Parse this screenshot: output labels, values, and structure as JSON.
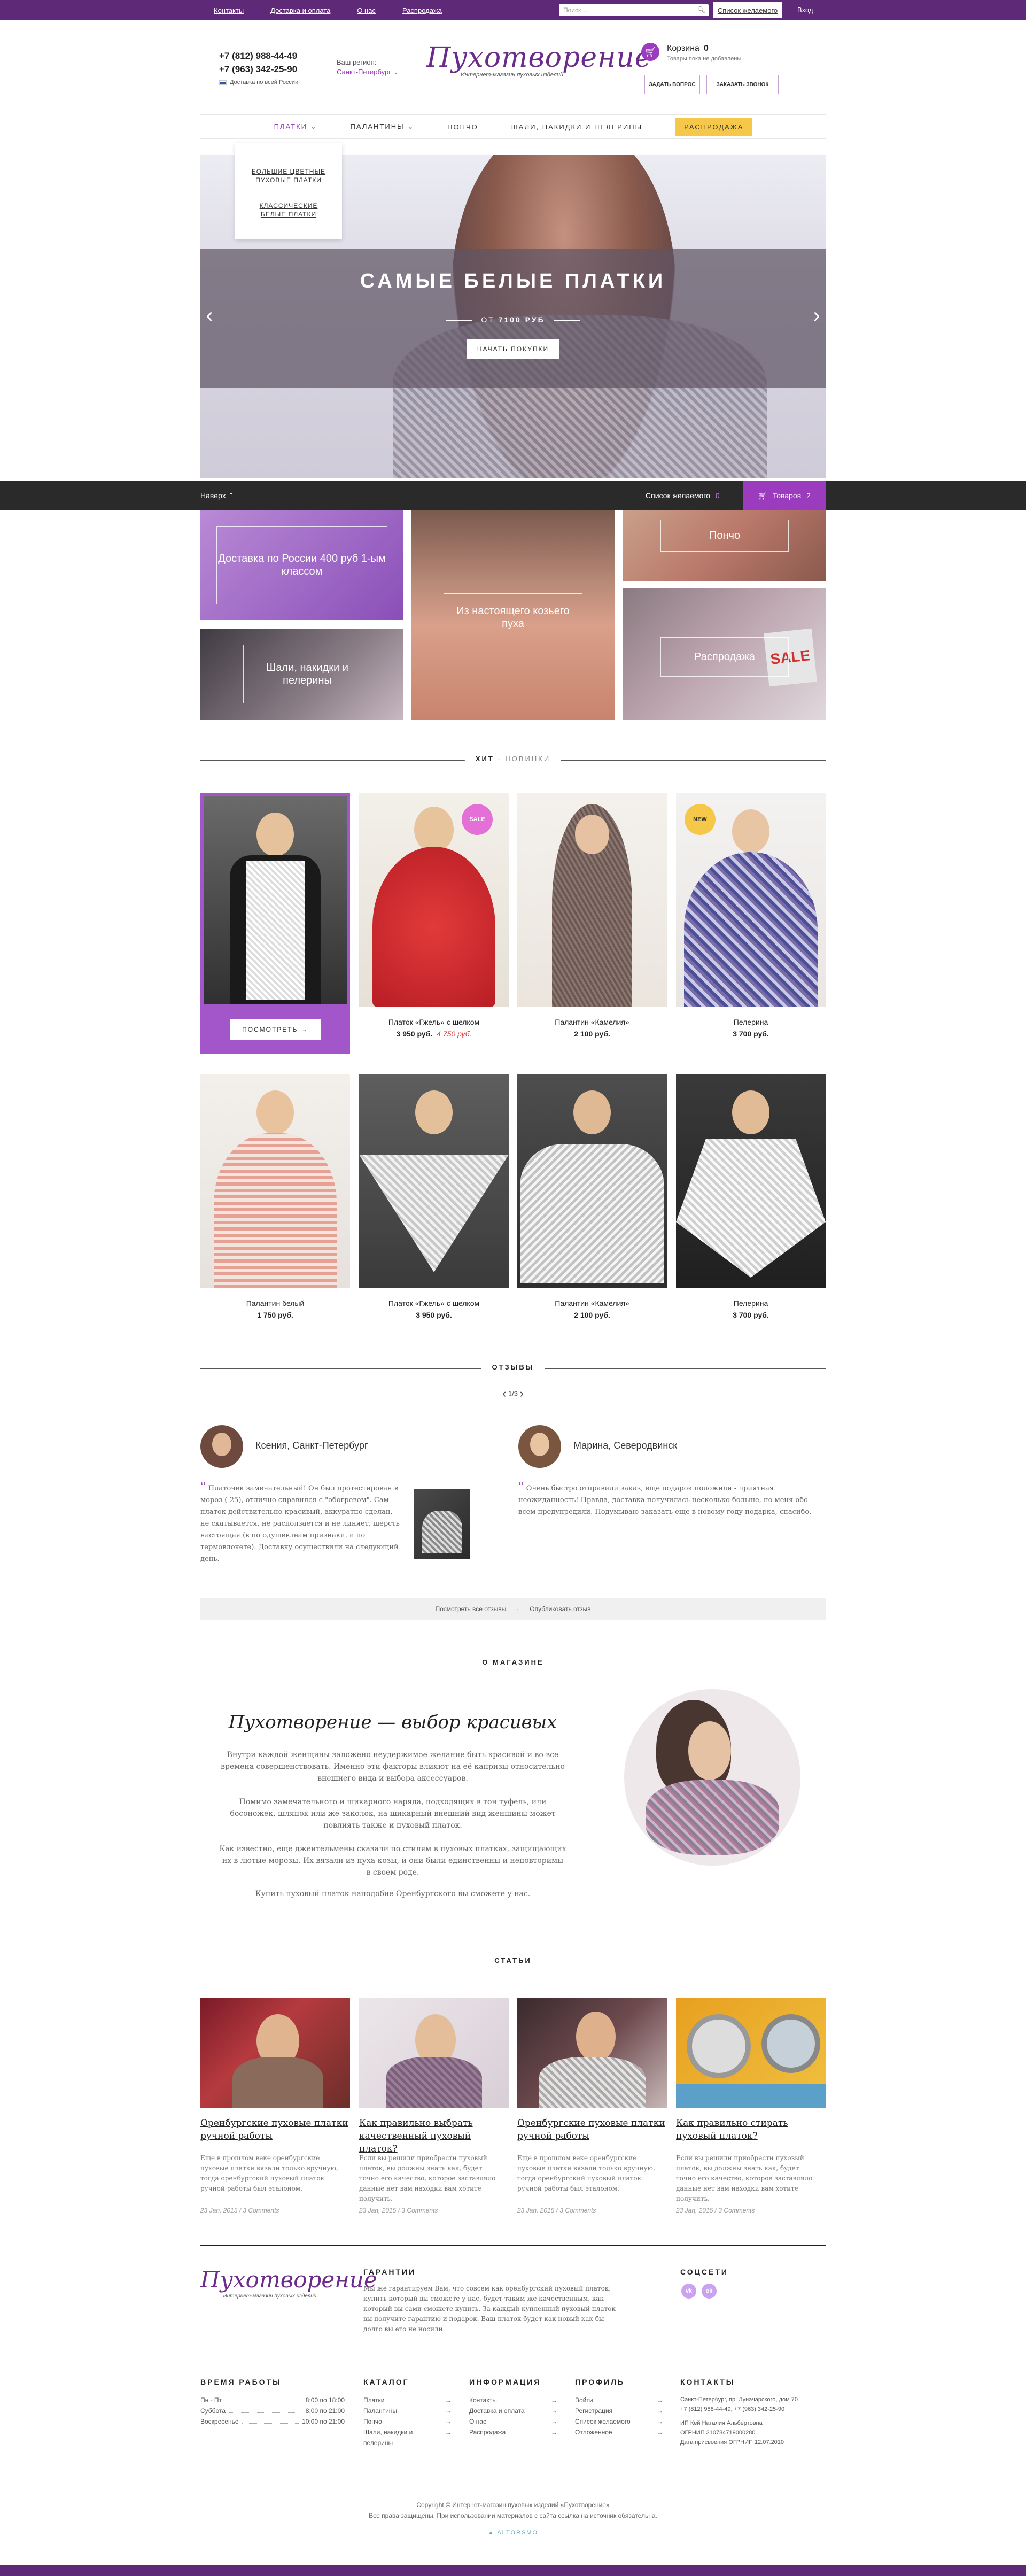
{
  "topbar": {
    "links": [
      "Контакты",
      "Доставка и оплата",
      "О нас",
      "Распродажа"
    ],
    "search_placeholder": "Поиск ...",
    "favorites": "Список желаемого",
    "login": "Вход"
  },
  "header": {
    "phone1": "+7 (812) 988-44-49",
    "phone2": "+7 (963) 342-25-90",
    "delivery_note": "Доставка по всей России",
    "region_label": "Ваш регион:",
    "region_value": "Санкт-Петербург",
    "logo_title": "Пухотворение",
    "logo_subtitle": "Интернет-магазин пуховых изделий",
    "cart_label": "Корзина",
    "cart_count": "0",
    "cart_note": "Товары пока не добавлены",
    "btn_question": "ЗАДАТЬ ВОПРОС",
    "btn_callback": "ЗАКАЗАТЬ ЗВОНОК"
  },
  "nav": {
    "items": [
      "ПЛАТКИ",
      "ПАЛАНТИНЫ",
      "ПОНЧО",
      "ШАЛИ, НАКИДКИ И ПЕЛЕРИНЫ"
    ],
    "sale": "РАСПРОДАЖА",
    "dropdown": [
      "БОЛЬШИЕ ЦВЕТНЫЕ ПУХОВЫЕ ПЛАТКИ",
      "КЛАССИЧЕСКИЕ БЕЛЫЕ ПЛАТКИ"
    ]
  },
  "hero": {
    "title": "САМЫЕ БЕЛЫЕ ПЛАТКИ",
    "price_prefix": "ОТ",
    "price": "7100 РУБ",
    "button": "НАЧАТЬ ПОКУПКИ"
  },
  "stickybar": {
    "up": "Наверх",
    "favorites": "Список желаемого",
    "fav_count": "0",
    "goods": "Товаров",
    "goods_count": "2"
  },
  "promos": {
    "delivery": "Доставка по России 400 руб 1-ым классом",
    "goat": "Из настоящего козьего пуха",
    "poncho": "Пончо",
    "shawls": "Шали, накидки и пелерины",
    "sale": "Распродажа",
    "sale_sign": "SALE"
  },
  "sections": {
    "hit": "ХИТ",
    "sep": "·",
    "new": "НОВИНКИ",
    "reviews": "ОТЗЫВЫ",
    "about": "О МАГАЗИНЕ",
    "articles": "СТАТЬИ"
  },
  "products": {
    "view_button": "ПОСМОТРЕТЬ",
    "row1": [
      {
        "name": "",
        "price": "",
        "old": ""
      },
      {
        "name": "Платок «Гжель» с шелком",
        "price": "3 950 руб.",
        "old": "4 750 руб."
      },
      {
        "name": "Палантин «Камелия»",
        "price": "2 100 руб.",
        "old": ""
      },
      {
        "name": "Пелерина",
        "price": "3 700 руб.",
        "old": ""
      }
    ],
    "row2": [
      {
        "name": "Палантин белый",
        "price": "1 750 руб."
      },
      {
        "name": "Платок «Гжель» с шелком",
        "price": "3 950 руб."
      },
      {
        "name": "Палантин «Камелия»",
        "price": "2 100 руб."
      },
      {
        "name": "Пелерина",
        "price": "3 700 руб."
      }
    ],
    "badge_sale": "SALE",
    "badge_new": "NEW"
  },
  "reviews": {
    "counter": "1/3",
    "items": [
      {
        "name": "Ксения, Санкт-Петербург",
        "text": "Платочек замечательный! Он был протестирован в мороз (-25), отлично справился с \"обогревом\". Сам платок действительно красивый, аккуратно сделан, не скатывается, не расползается и не линяет, шерсть настоящая (в по одушевлеам признаки, и по термовлокете). Доставку осуществили на следующий день."
      },
      {
        "name": "Марина, Северодвинск",
        "text": "Очень быстро отправили заказ, еще подарок положили - приятная неожиданность! Правда, доставка получилась несколько больше, но меня обо всем предупредили. Подумываю заказать еще в новому году подарка, спасибо."
      }
    ],
    "all_link": "Посмотреть все отзывы",
    "publish_link": "Опубликовать отзыв"
  },
  "about": {
    "heading": "Пухотворение — выбор красивых",
    "p1": "Внутри каждой женщины заложено неудержимое желание быть красивой и во все времена совершенствовать. Именно эти факторы влияют на её капризы относительно внешнего вида и выбора аксессуаров.",
    "p2": "Помимо замечательного и шикарного наряда, подходящих в тон туфель, или босоножек, шляпок или же заколок, на шикарный внешний вид женщины может повлиять также и пуховый платок.",
    "p3": "Как известно, еще джентельмены сказали по стилям в пуховых платках, защищающих их в лютые морозы. Их вязали из пуха козы, и они были единственны и неповторимы в своем роде.",
    "p4": "Купить пуховый платок наподобие Оренбургского вы сможете у нас."
  },
  "articles": [
    {
      "title": "Оренбургские пуховые платки ручной работы",
      "desc": "Еще в прошлом веке оренбургские пуховые платки вязали только вручную, тогда оренбургский пуховый платок ручной работы был эталоном.",
      "meta": "23 Jan, 2015 / 3 Comments"
    },
    {
      "title": "Как правильно выбрать качественный пуховый платок?",
      "desc": "Если вы решили приобрести пуховый платок, вы должны знать как, будет точно его качество, которое заставляло данные нет вам находки вам хотите получить.",
      "meta": "23 Jan, 2015 / 3 Comments"
    },
    {
      "title": "Оренбургские пуховые платки ручной работы",
      "desc": "Еще в прошлом веке оренбургские пуховые платки вязали только вручную, тогда оренбургский пуховый платок ручной работы был эталоном.",
      "meta": "23 Jan, 2015 / 3 Comments"
    },
    {
      "title": "Как правильно стирать пуховый платок?",
      "desc": "Если вы решили приобрести пуховый платок, вы должны знать как, будет точно его качество, которое заставляло данные нет вам находки вам хотите получить.",
      "meta": "23 Jan, 2015 / 3 Comments"
    }
  ],
  "footer": {
    "logo_title": "Пухотворение",
    "logo_subtitle": "Интернет-магазин пуховых изделий",
    "guarantee_h": "ГАРАНТИИ",
    "guarantee_text": "Мы же гарантируем Вам, что совсем как оренбургский пуховый платок, купить который вы сможете у нас, будет таким же качественным, как который вы сами сможете купить. За каждый купленный пуховый платок вы получите гарантию и подарок. Ваш платок будет как новый как бы долго вы его не носили.",
    "social_h": "СОЦСЕТИ",
    "soc1": "vk",
    "soc2": "ok",
    "hours_h": "ВРЕМЯ РАБОТЫ",
    "hours": [
      {
        "d": "Пн - Пт",
        "t": "8:00 по 18:00"
      },
      {
        "d": "Суббота",
        "t": "8:00 по 21:00"
      },
      {
        "d": "Воскресенье",
        "t": "10:00 по 21:00"
      }
    ],
    "catalog_h": "КАТАЛОГ",
    "catalog": [
      "Платки",
      "Палантины",
      "Пончо",
      "Шали, накидки и пелерины"
    ],
    "info_h": "ИНФОРМАЦИЯ",
    "info": [
      "Контакты",
      "Доставка и оплата",
      "О нас",
      "Распродажа"
    ],
    "profile_h": "ПРОФИЛЬ",
    "profile": [
      "Войти",
      "Регистрация",
      "Список желаемого",
      "Отложенное"
    ],
    "contacts_h": "КОНТАКТЫ",
    "contacts": [
      "Санкт-Петербург, пр. Луначарского, дом 70",
      "+7 (812) 988-44-49, +7 (963) 342-25-90",
      "ИП Кей Наталия Альбертовна",
      "ОГРНИП 310784719000280",
      "Дата присвоения ОГРНИП 12.07.2010"
    ],
    "arrow": "→",
    "copyright": "Copyright © Интернет-магазин пуховых изделий «Пухотворение»",
    "rights": "Все права защищены. При использовании материалов с сайта ссылка на источник обязательна.",
    "developer": "ALTORSMO"
  },
  "colors": {
    "purple": "#5e2a78",
    "accent": "#9b3bbd",
    "sale": "#f5c84a",
    "dark": "#2a2a2a"
  }
}
